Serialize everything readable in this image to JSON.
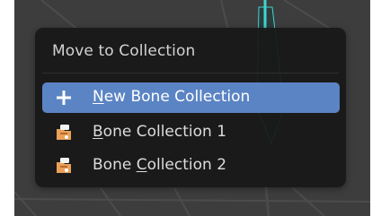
{
  "menu": {
    "title": "Move to Collection",
    "items": [
      {
        "label_mnemonic": "N",
        "label_rest": "ew Bone Collection",
        "icon": "plus-icon",
        "active": true
      },
      {
        "label_mnemonic": "B",
        "label_rest": "one Collection 1",
        "icon": "bone-collection-icon",
        "active": false
      },
      {
        "label_pre": "Bone ",
        "label_mnemonic": "C",
        "label_rest": "ollection 2",
        "icon": "bone-collection-icon",
        "active": false
      }
    ]
  },
  "colors": {
    "viewport_bg": "#3d3d3d",
    "menu_bg": "#181818",
    "highlight": "#5b84c4",
    "bone_accent": "#3fd6d0",
    "icon_orange": "#e9a15a"
  }
}
